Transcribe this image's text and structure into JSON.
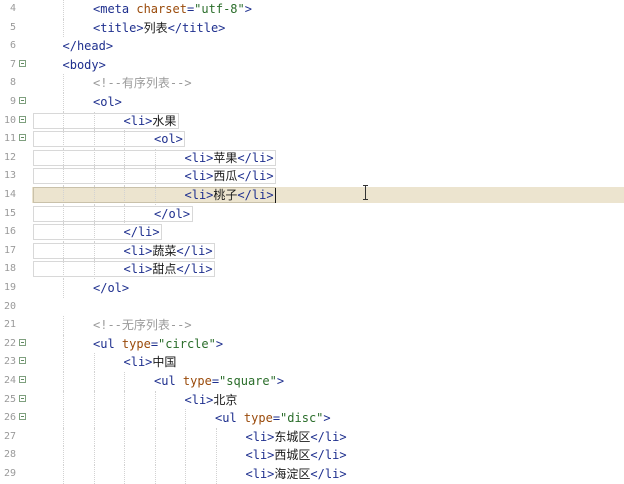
{
  "editor": {
    "lines": [
      {
        "num": "4",
        "fold": false,
        "indent": 2,
        "segments": [
          {
            "t": "tag",
            "v": "<meta "
          },
          {
            "t": "attr",
            "v": "charset"
          },
          {
            "t": "tag",
            "v": "="
          },
          {
            "t": "str",
            "v": "\"utf-8\""
          },
          {
            "t": "tag",
            "v": ">"
          }
        ]
      },
      {
        "num": "5",
        "fold": false,
        "indent": 2,
        "segments": [
          {
            "t": "tag",
            "v": "<title>"
          },
          {
            "t": "txt",
            "v": "列表"
          },
          {
            "t": "tag",
            "v": "</title>"
          }
        ]
      },
      {
        "num": "6",
        "fold": false,
        "indent": 1,
        "segments": [
          {
            "t": "tag",
            "v": "</head>"
          }
        ]
      },
      {
        "num": "7",
        "fold": true,
        "indent": 1,
        "segments": [
          {
            "t": "tag",
            "v": "<body>"
          }
        ]
      },
      {
        "num": "8",
        "fold": false,
        "indent": 2,
        "segments": [
          {
            "t": "cmt",
            "v": "<!--有序列表-->"
          }
        ]
      },
      {
        "num": "9",
        "fold": true,
        "indent": 2,
        "segments": [
          {
            "t": "tag",
            "v": "<ol>"
          }
        ]
      },
      {
        "num": "10",
        "fold": true,
        "indent": 3,
        "segments": [
          {
            "t": "tag",
            "v": "<li>"
          },
          {
            "t": "txt",
            "v": "水果"
          }
        ]
      },
      {
        "num": "11",
        "fold": true,
        "indent": 4,
        "segments": [
          {
            "t": "tag",
            "v": "<ol>"
          }
        ]
      },
      {
        "num": "12",
        "fold": false,
        "indent": 5,
        "segments": [
          {
            "t": "tag",
            "v": "<li>"
          },
          {
            "t": "txt",
            "v": "苹果"
          },
          {
            "t": "tag",
            "v": "</li>"
          }
        ]
      },
      {
        "num": "13",
        "fold": false,
        "indent": 5,
        "segments": [
          {
            "t": "tag",
            "v": "<li>"
          },
          {
            "t": "txt",
            "v": "西瓜"
          },
          {
            "t": "tag",
            "v": "</li>"
          }
        ]
      },
      {
        "num": "14",
        "fold": false,
        "indent": 5,
        "current": true,
        "segments": [
          {
            "t": "tag",
            "v": "<li>"
          },
          {
            "t": "txt",
            "v": "桃子"
          },
          {
            "t": "tag",
            "v": "</li>"
          }
        ]
      },
      {
        "num": "15",
        "fold": false,
        "indent": 4,
        "segments": [
          {
            "t": "tag",
            "v": "</ol>"
          }
        ]
      },
      {
        "num": "16",
        "fold": false,
        "indent": 3,
        "segments": [
          {
            "t": "tag",
            "v": "</li>"
          }
        ]
      },
      {
        "num": "17",
        "fold": false,
        "indent": 3,
        "segments": [
          {
            "t": "tag",
            "v": "<li>"
          },
          {
            "t": "txt",
            "v": "蔬菜"
          },
          {
            "t": "tag",
            "v": "</li>"
          }
        ]
      },
      {
        "num": "18",
        "fold": false,
        "indent": 3,
        "segments": [
          {
            "t": "tag",
            "v": "<li>"
          },
          {
            "t": "txt",
            "v": "甜点"
          },
          {
            "t": "tag",
            "v": "</li>"
          }
        ]
      },
      {
        "num": "19",
        "fold": false,
        "indent": 2,
        "segments": [
          {
            "t": "tag",
            "v": "</ol>"
          }
        ]
      },
      {
        "num": "20",
        "fold": false,
        "indent": 0,
        "segments": []
      },
      {
        "num": "21",
        "fold": false,
        "indent": 2,
        "segments": [
          {
            "t": "cmt",
            "v": "<!--无序列表-->"
          }
        ]
      },
      {
        "num": "22",
        "fold": true,
        "indent": 2,
        "segments": [
          {
            "t": "tag",
            "v": "<ul "
          },
          {
            "t": "attr",
            "v": "type"
          },
          {
            "t": "tag",
            "v": "="
          },
          {
            "t": "str",
            "v": "\"circle\""
          },
          {
            "t": "tag",
            "v": ">"
          }
        ]
      },
      {
        "num": "23",
        "fold": true,
        "indent": 3,
        "segments": [
          {
            "t": "tag",
            "v": "<li>"
          },
          {
            "t": "txt",
            "v": "中国"
          }
        ]
      },
      {
        "num": "24",
        "fold": true,
        "indent": 4,
        "segments": [
          {
            "t": "tag",
            "v": "<ul "
          },
          {
            "t": "attr",
            "v": "type"
          },
          {
            "t": "tag",
            "v": "="
          },
          {
            "t": "str",
            "v": "\"square\""
          },
          {
            "t": "tag",
            "v": ">"
          }
        ]
      },
      {
        "num": "25",
        "fold": true,
        "indent": 5,
        "segments": [
          {
            "t": "tag",
            "v": "<li>"
          },
          {
            "t": "txt",
            "v": "北京"
          }
        ]
      },
      {
        "num": "26",
        "fold": true,
        "indent": 6,
        "segments": [
          {
            "t": "tag",
            "v": "<ul "
          },
          {
            "t": "attr",
            "v": "type"
          },
          {
            "t": "tag",
            "v": "="
          },
          {
            "t": "str",
            "v": "\"disc\""
          },
          {
            "t": "tag",
            "v": ">"
          }
        ]
      },
      {
        "num": "27",
        "fold": false,
        "indent": 7,
        "segments": [
          {
            "t": "tag",
            "v": "<li>"
          },
          {
            "t": "txt",
            "v": "东城区"
          },
          {
            "t": "tag",
            "v": "</li>"
          }
        ]
      },
      {
        "num": "28",
        "fold": false,
        "indent": 7,
        "segments": [
          {
            "t": "tag",
            "v": "<li>"
          },
          {
            "t": "txt",
            "v": "西城区"
          },
          {
            "t": "tag",
            "v": "</li>"
          }
        ]
      },
      {
        "num": "29",
        "fold": false,
        "indent": 7,
        "segments": [
          {
            "t": "tag",
            "v": "<li>"
          },
          {
            "t": "txt",
            "v": "海淀区"
          },
          {
            "t": "tag",
            "v": "</li>"
          }
        ]
      }
    ],
    "colors": {
      "tag": "#1e2f8e",
      "attr": "#9a4a0a",
      "string": "#2a6d2a",
      "comment": "#9a9a9a",
      "current_line": "#ece4cf"
    },
    "icons": {
      "fold_marker": "fold-minus-icon",
      "cursor": "ibeam-cursor-icon"
    }
  }
}
